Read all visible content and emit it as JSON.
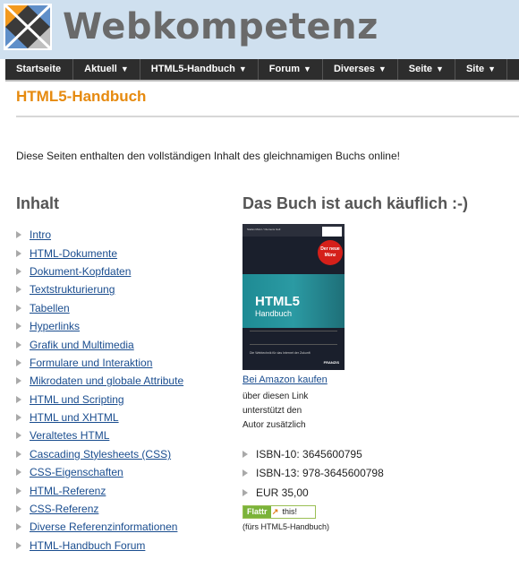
{
  "site": {
    "title": "Webkompetenz"
  },
  "nav": [
    {
      "label": "Startseite",
      "dropdown": false
    },
    {
      "label": "Aktuell",
      "dropdown": true
    },
    {
      "label": "HTML5-Handbuch",
      "dropdown": true
    },
    {
      "label": "Forum",
      "dropdown": true
    },
    {
      "label": "Diverses",
      "dropdown": true
    },
    {
      "label": "Seite",
      "dropdown": true
    },
    {
      "label": "Site",
      "dropdown": true
    }
  ],
  "page": {
    "title": "HTML5-Handbuch",
    "intro": "Diese Seiten enthalten den vollständigen Inhalt des gleichnamigen Buchs online!"
  },
  "toc": {
    "heading": "Inhalt",
    "items": [
      "Intro",
      "HTML-Dokumente",
      "Dokument-Kopfdaten",
      "Textstrukturierung",
      "Tabellen",
      "Hyperlinks",
      "Grafik und Multimedia",
      "Formulare und Interaktion",
      "Mikrodaten und globale Attribute",
      "HTML und Scripting",
      "HTML und XHTML",
      "Veraltetes HTML",
      "Cascading Stylesheets (CSS)",
      "CSS-Eigenschaften",
      "HTML-Referenz",
      "CSS-Referenz",
      "Diverse Referenzinformationen",
      "HTML-Handbuch Forum"
    ]
  },
  "book": {
    "heading": "Das Buch ist auch käuflich :-)",
    "cover": {
      "authors": "Stefan Münz / Clemens Gull",
      "badge": "Der neue Münz",
      "title": "HTML5",
      "subtitle": "Handbuch",
      "tagline": "Die Webtechnik für das Internet der Zukunft",
      "publisher": "FRANZIS"
    },
    "amazon_link": "Bei Amazon kaufen",
    "note_lines": [
      "über diesen Link",
      "unterstützt den",
      "Autor zusätzlich"
    ],
    "isbn10": "ISBN-10: 3645600795",
    "isbn13": "ISBN-13: 978-3645600798",
    "price": "EUR 35,00",
    "flattr": {
      "label": "Flattr",
      "action": "this!",
      "note": "(fürs HTML5-Handbuch)"
    }
  },
  "colors": {
    "accent": "#e68a0f",
    "nav_bg": "#2d2d2d",
    "header_bg": "#cfe0ef",
    "link": "#1a4d8f"
  }
}
